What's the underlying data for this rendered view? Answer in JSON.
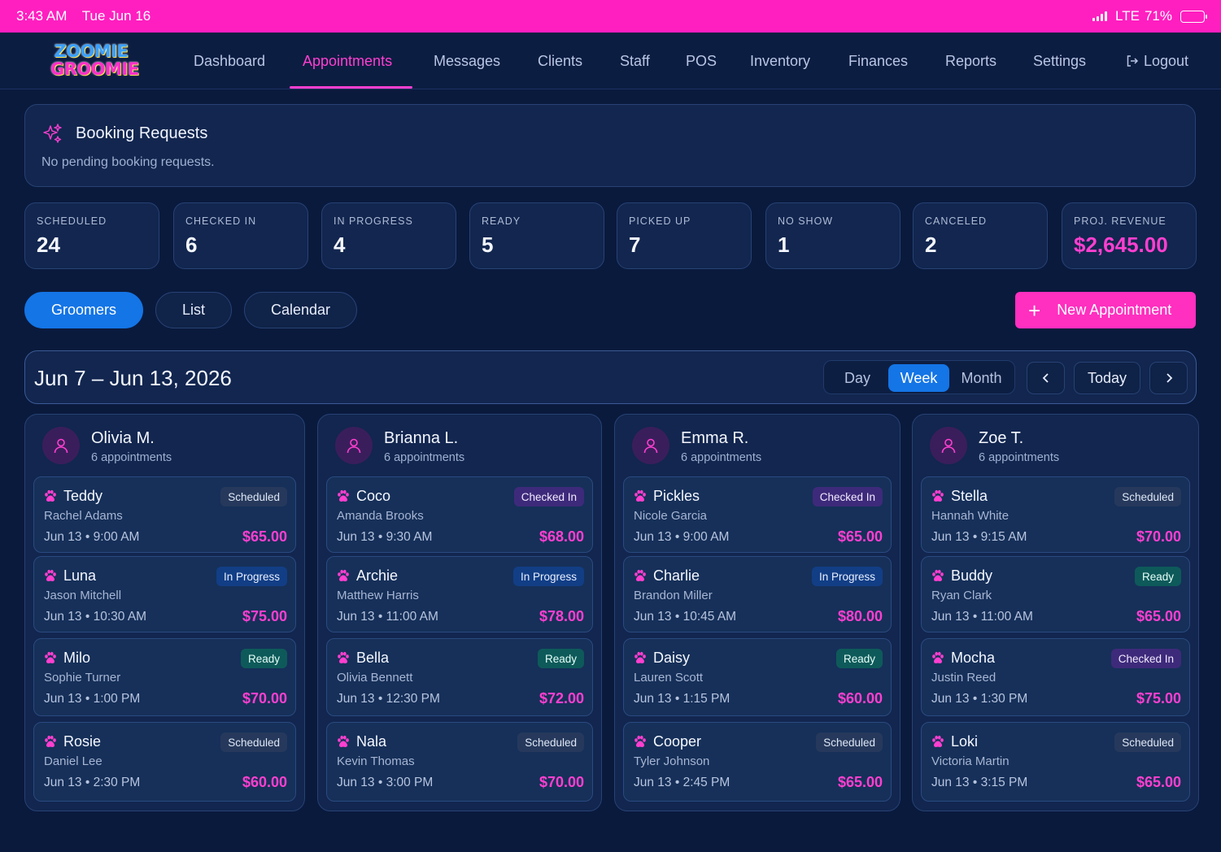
{
  "status_bar": {
    "time": "3:43 AM",
    "date": "Tue Jun 16",
    "network": "LTE",
    "battery": "71%",
    "battery_level": 0.71
  },
  "logo": {
    "line1": "ZOOMIE",
    "line2": "GROOMIE"
  },
  "nav": {
    "items": [
      {
        "label": "Dashboard",
        "active": false
      },
      {
        "label": "Appointments",
        "active": true
      },
      {
        "label": "Messages",
        "active": false
      },
      {
        "label": "Clients",
        "active": false
      },
      {
        "label": "Staff",
        "active": false
      },
      {
        "label": "POS",
        "active": false
      },
      {
        "label": "Inventory",
        "active": false
      },
      {
        "label": "Finances",
        "active": false
      },
      {
        "label": "Reports",
        "active": false
      },
      {
        "label": "Settings",
        "active": false
      }
    ],
    "logout": "Logout"
  },
  "booking": {
    "title": "Booking Requests",
    "message": "No pending booking requests.",
    "icon": "sparkles-icon"
  },
  "stats": [
    {
      "label": "SCHEDULED",
      "value": "24"
    },
    {
      "label": "CHECKED IN",
      "value": "6"
    },
    {
      "label": "IN PROGRESS",
      "value": "4"
    },
    {
      "label": "READY",
      "value": "5"
    },
    {
      "label": "PICKED UP",
      "value": "7"
    },
    {
      "label": "NO SHOW",
      "value": "1"
    },
    {
      "label": "CANCELED",
      "value": "2"
    },
    {
      "label": "PROJ. REVENUE",
      "value": "$2,645.00"
    }
  ],
  "view_tabs": [
    {
      "label": "Groomers",
      "active": true
    },
    {
      "label": "List",
      "active": false
    },
    {
      "label": "Calendar",
      "active": false
    }
  ],
  "new_appointment": {
    "plus": "+",
    "label": "New Appointment"
  },
  "week": {
    "range": "Jun 7 – Jun 13, 2026",
    "modes": [
      {
        "label": "Day",
        "active": false
      },
      {
        "label": "Week",
        "active": true
      },
      {
        "label": "Month",
        "active": false
      }
    ],
    "prev": "‹",
    "today": "Today",
    "next": "›"
  },
  "colors": {
    "accent": "#ff3fd0",
    "primary": "#1475e6",
    "background": "#0a1a3d",
    "status_bar": "#ff1fc0"
  },
  "groomers": [
    {
      "name": "Olivia M.",
      "count": "6 appointments",
      "appointments": [
        {
          "pet": "Teddy",
          "owner": "Rachel Adams",
          "when": "Jun 13 • 9:00 AM",
          "price": "$65.00",
          "status": "Scheduled"
        },
        {
          "pet": "Luna",
          "owner": "Jason Mitchell",
          "when": "Jun 13 • 10:30 AM",
          "price": "$75.00",
          "status": "In Progress"
        },
        {
          "pet": "Milo",
          "owner": "Sophie Turner",
          "when": "Jun 13 • 1:00 PM",
          "price": "$70.00",
          "status": "Ready"
        },
        {
          "pet": "Rosie",
          "owner": "Daniel Lee",
          "when": "Jun 13 • 2:30 PM",
          "price": "$60.00",
          "status": "Scheduled"
        }
      ]
    },
    {
      "name": "Brianna L.",
      "count": "6 appointments",
      "appointments": [
        {
          "pet": "Coco",
          "owner": "Amanda Brooks",
          "when": "Jun 13 • 9:30 AM",
          "price": "$68.00",
          "status": "Checked In"
        },
        {
          "pet": "Archie",
          "owner": "Matthew Harris",
          "when": "Jun 13 • 11:00 AM",
          "price": "$78.00",
          "status": "In Progress"
        },
        {
          "pet": "Bella",
          "owner": "Olivia Bennett",
          "when": "Jun 13 • 12:30 PM",
          "price": "$72.00",
          "status": "Ready"
        },
        {
          "pet": "Nala",
          "owner": "Kevin Thomas",
          "when": "Jun 13 • 3:00 PM",
          "price": "$70.00",
          "status": "Scheduled"
        }
      ]
    },
    {
      "name": "Emma R.",
      "count": "6 appointments",
      "appointments": [
        {
          "pet": "Pickles",
          "owner": "Nicole Garcia",
          "when": "Jun 13 • 9:00 AM",
          "price": "$65.00",
          "status": "Checked In"
        },
        {
          "pet": "Charlie",
          "owner": "Brandon Miller",
          "when": "Jun 13 • 10:45 AM",
          "price": "$80.00",
          "status": "In Progress"
        },
        {
          "pet": "Daisy",
          "owner": "Lauren Scott",
          "when": "Jun 13 • 1:15 PM",
          "price": "$60.00",
          "status": "Ready"
        },
        {
          "pet": "Cooper",
          "owner": "Tyler Johnson",
          "when": "Jun 13 • 2:45 PM",
          "price": "$65.00",
          "status": "Scheduled"
        }
      ]
    },
    {
      "name": "Zoe T.",
      "count": "6 appointments",
      "appointments": [
        {
          "pet": "Stella",
          "owner": "Hannah White",
          "when": "Jun 13 • 9:15 AM",
          "price": "$70.00",
          "status": "Scheduled"
        },
        {
          "pet": "Buddy",
          "owner": "Ryan Clark",
          "when": "Jun 13 • 11:00 AM",
          "price": "$65.00",
          "status": "Ready"
        },
        {
          "pet": "Mocha",
          "owner": "Justin Reed",
          "when": "Jun 13 • 1:30 PM",
          "price": "$75.00",
          "status": "Checked In"
        },
        {
          "pet": "Loki",
          "owner": "Victoria Martin",
          "when": "Jun 13 • 3:15 PM",
          "price": "$65.00",
          "status": "Scheduled"
        }
      ]
    }
  ]
}
